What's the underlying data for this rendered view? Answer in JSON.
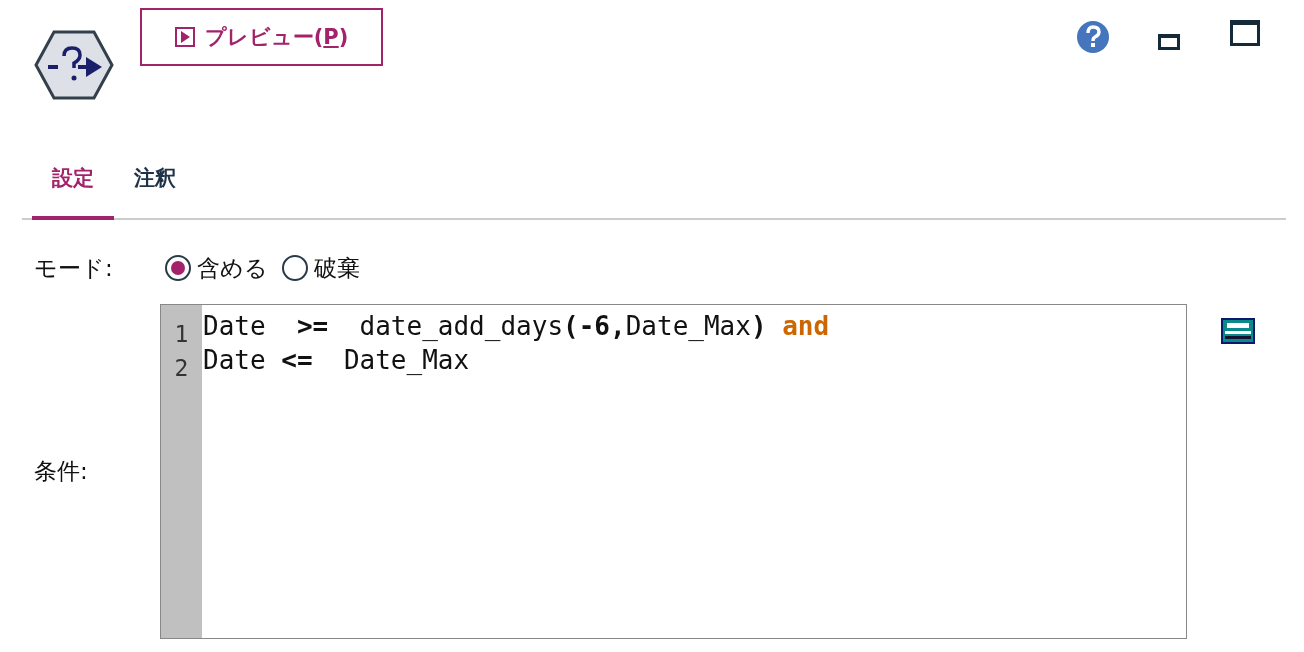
{
  "preview_button": {
    "label_parts": [
      {
        "text": "プレビュー(",
        "underline": false
      },
      {
        "text": "P",
        "underline": true
      },
      {
        "text": ")",
        "underline": false
      }
    ]
  },
  "tabs": [
    {
      "label": "設定",
      "selected": true
    },
    {
      "label": "注釈",
      "selected": false
    }
  ],
  "mode": {
    "label": "モード:",
    "options": [
      {
        "label": "含める",
        "selected": true
      },
      {
        "label": "破棄",
        "selected": false
      }
    ]
  },
  "condition": {
    "label": "条件:",
    "lines": [
      {
        "number": "1",
        "tokens": [
          {
            "text": "Date  ",
            "kind": "text"
          },
          {
            "text": ">=",
            "kind": "op"
          },
          {
            "text": "  date_add_days",
            "kind": "text"
          },
          {
            "text": "(-6,",
            "kind": "op"
          },
          {
            "text": "Date_Max",
            "kind": "text"
          },
          {
            "text": ") ",
            "kind": "op"
          },
          {
            "text": "and",
            "kind": "keyword"
          }
        ]
      },
      {
        "number": "2",
        "tokens": [
          {
            "text": "Date ",
            "kind": "text"
          },
          {
            "text": "<=",
            "kind": "op"
          },
          {
            "text": "  Date_Max",
            "kind": "text"
          }
        ]
      }
    ]
  }
}
